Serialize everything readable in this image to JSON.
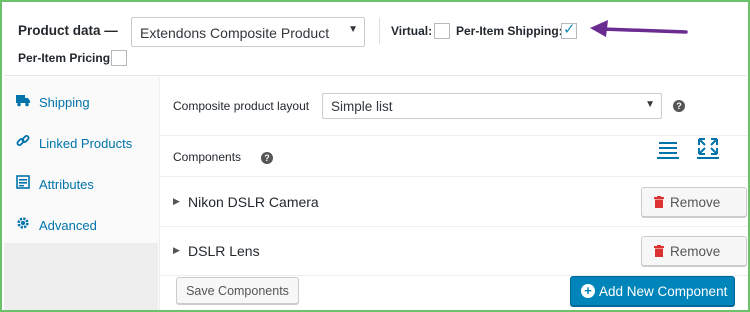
{
  "header": {
    "title": "Product data —",
    "product_type": "Extendons Composite Product",
    "virtual_label": "Virtual:",
    "virtual_checked": false,
    "per_item_shipping_label": "Per-Item Shipping:",
    "per_item_shipping_checked": true,
    "per_item_pricing_label": "Per-Item Pricing:",
    "per_item_pricing_checked": false
  },
  "sidebar": {
    "items": [
      {
        "label": "Shipping",
        "icon": "truck-icon"
      },
      {
        "label": "Linked Products",
        "icon": "link-icon"
      },
      {
        "label": "Attributes",
        "icon": "list-icon"
      },
      {
        "label": "Advanced",
        "icon": "gear-icon"
      }
    ]
  },
  "main": {
    "layout_label": "Composite product layout",
    "layout_value": "Simple list",
    "components_label": "Components",
    "components": [
      {
        "name": "Nikon DSLR Camera",
        "remove_label": "Remove"
      },
      {
        "name": "DSLR Lens",
        "remove_label": "Remove"
      }
    ],
    "save_label": "Save Components",
    "add_label": "Add New Component"
  },
  "colors": {
    "accent": "#0073aa",
    "primary_button": "#0085ba",
    "remove_icon": "#dc3232",
    "annotation_arrow": "#6b2c91",
    "frame": "#6cc16b"
  }
}
